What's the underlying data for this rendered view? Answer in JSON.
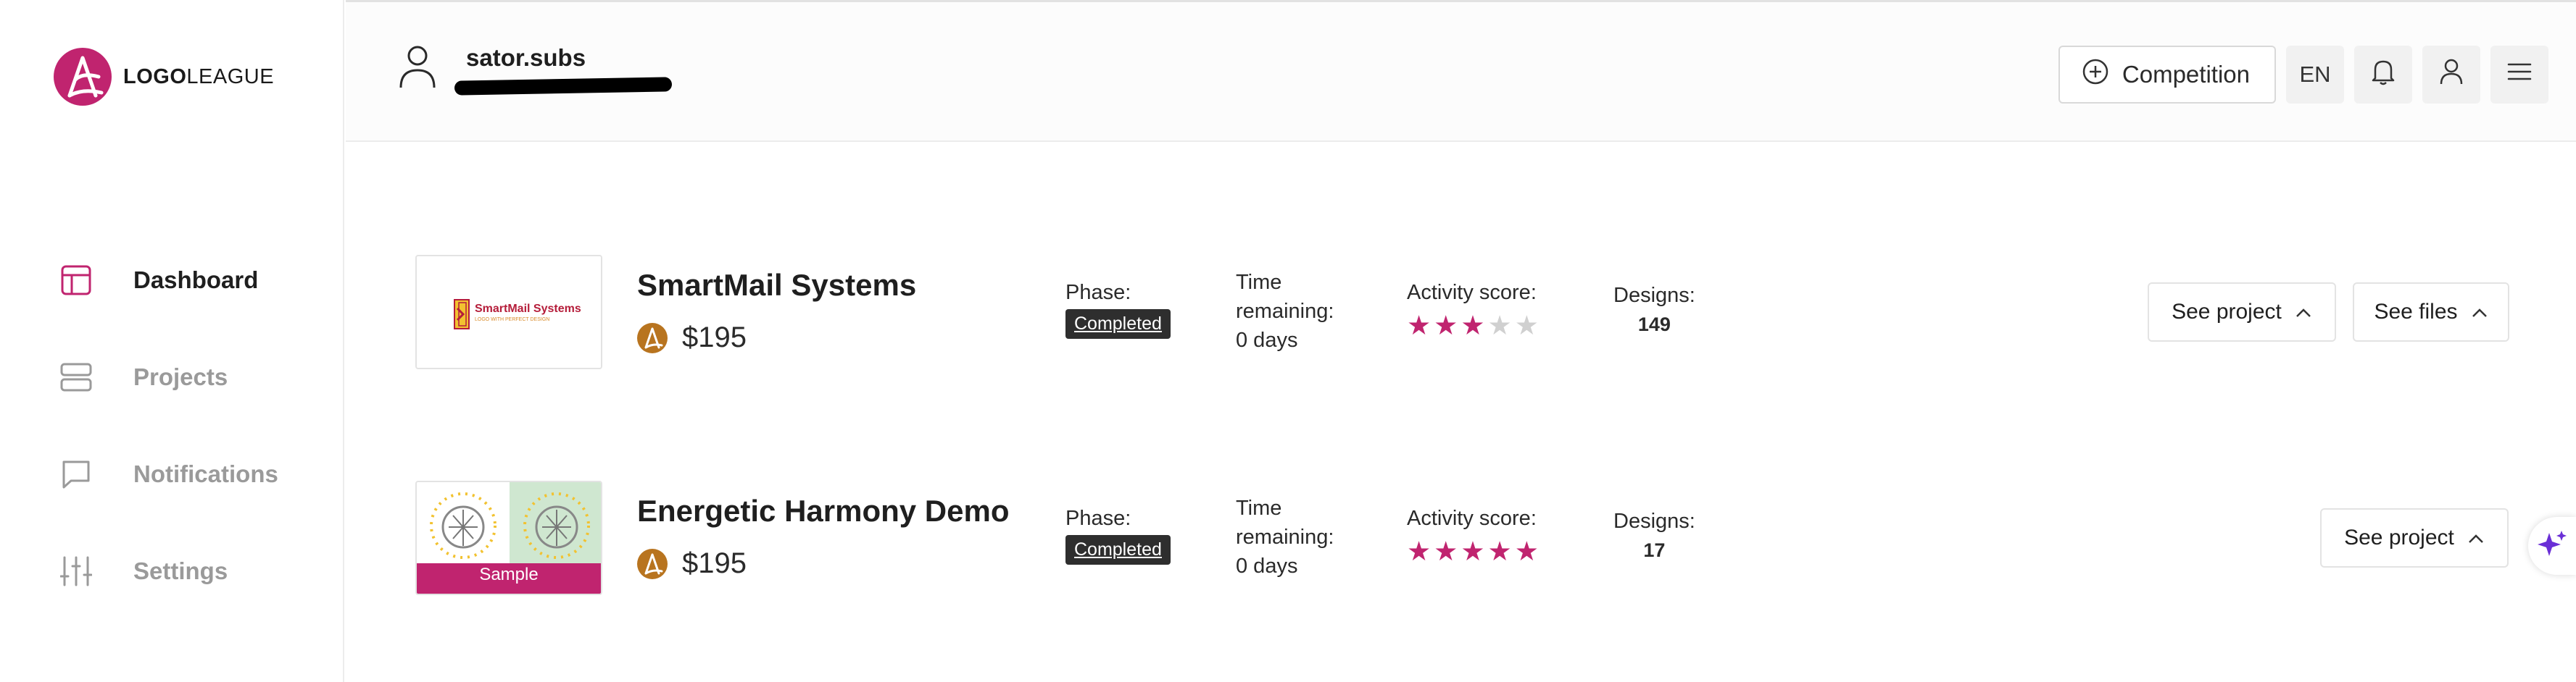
{
  "brand": {
    "logo_bold": "LOGO",
    "logo_light": "LEAGUE",
    "accent": "#c0246f"
  },
  "sidebar": {
    "items": [
      {
        "label": "Dashboard",
        "icon": "dashboard-icon",
        "active": true
      },
      {
        "label": "Projects",
        "icon": "projects-icon",
        "active": false
      },
      {
        "label": "Notifications",
        "icon": "chat-bubble-icon",
        "active": false
      },
      {
        "label": "Settings",
        "icon": "sliders-icon",
        "active": false
      }
    ]
  },
  "header": {
    "username": "sator.subs",
    "competition_label": "Competition",
    "language": "EN"
  },
  "projects": [
    {
      "name": "SmartMail Systems",
      "thumb_text": "SmartMail Systems",
      "thumb_subtext": "LOGO WITH PERFECT DESIGN",
      "price": "$195",
      "phase_label": "Phase:",
      "phase": "Completed",
      "time_line1": "Time",
      "time_line2": "remaining:",
      "time_line3": "0 days",
      "activity_label": "Activity score:",
      "activity_stars": 3,
      "designs_label": "Designs:",
      "designs": "149",
      "see_project": "See project",
      "see_files": "See files"
    },
    {
      "name": "Energetic Harmony Demo",
      "thumb_badge": "Sample",
      "price": "$195",
      "phase_label": "Phase:",
      "phase": "Completed",
      "time_line1": "Time",
      "time_line2": "remaining:",
      "time_line3": "0 days",
      "activity_label": "Activity score:",
      "activity_stars": 5,
      "designs_label": "Designs:",
      "designs": "17",
      "see_project": "See project"
    }
  ]
}
